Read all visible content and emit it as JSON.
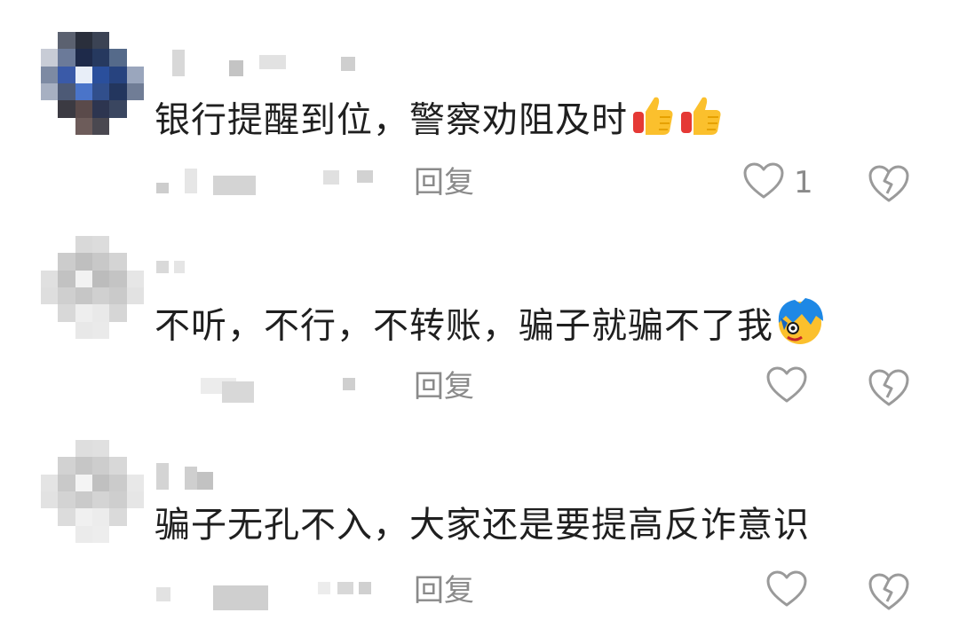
{
  "comments": [
    {
      "text": "银行提醒到位，警察劝阻及时",
      "emoji": [
        "thumbs-up-icon",
        "thumbs-up-icon"
      ],
      "reply_label": "回复",
      "like_count": "1"
    },
    {
      "text": "不听，不行，不转账，骗子就骗不了我",
      "emoji": [
        "blue-hair-face-icon"
      ],
      "reply_label": "回复",
      "like_count": ""
    },
    {
      "text": "骗子无孔不入，大家还是要提高反诈意识",
      "emoji": [],
      "reply_label": "回复",
      "like_count": ""
    }
  ]
}
